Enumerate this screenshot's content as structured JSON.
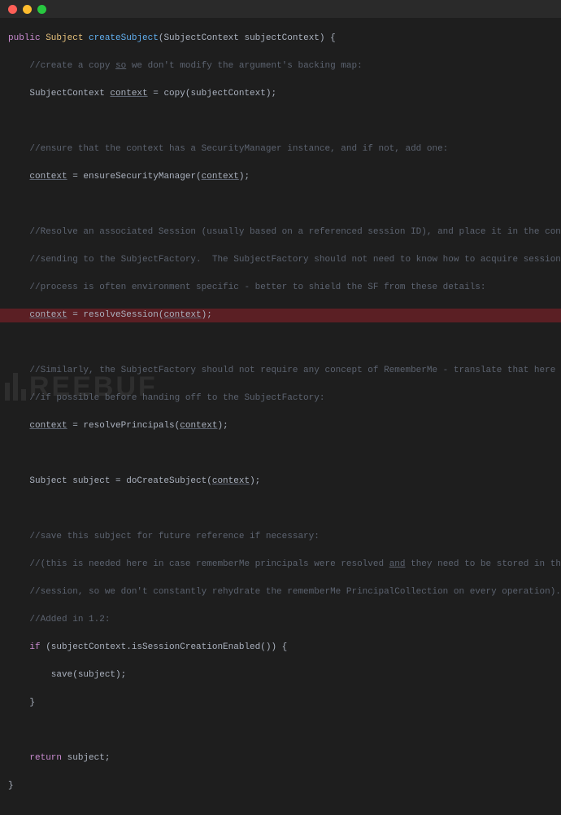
{
  "titlebar": {
    "dots": [
      "red",
      "yellow",
      "green"
    ]
  },
  "watermark": "REEBUF",
  "code": {
    "l01a": "public",
    "l01b": " Subject ",
    "l01c": "createSubject",
    "l01d": "(SubjectContext subjectContext) {",
    "l02a": "    //create a copy ",
    "l02b": "so",
    "l02c": " we don't modify the argument's backing map:",
    "l03a": "    SubjectContext ",
    "l03b": "context",
    "l03c": " = copy(subjectContext);",
    "l05": "    //ensure that the context has a SecurityManager instance, and if not, add one:",
    "l06a": "    ",
    "l06b": "context",
    "l06c": " = ensureSecurityManager(",
    "l06d": "context",
    "l06e": ");",
    "l08": "    //Resolve an associated Session (usually based on a referenced session ID), and place it in the context before",
    "l09": "    //sending to the SubjectFactory.  The SubjectFactory should not need to know how to acquire sessions as the",
    "l10": "    //process is often environment specific - better to shield the SF from these details:",
    "l11a": "    ",
    "l11b": "context",
    "l11c": " = resolveSession(",
    "l11d": "context",
    "l11e": ");",
    "l13": "    //Similarly, the SubjectFactory should not require any concept of RememberMe - translate that here first",
    "l14": "    //if possible before handing off to the SubjectFactory:",
    "l15a": "    ",
    "l15b": "context",
    "l15c": " = resolvePrincipals(",
    "l15d": "context",
    "l15e": ");",
    "l17a": "    Subject subject = doCreateSubject(",
    "l17b": "context",
    "l17c": ");",
    "l19": "    //save this subject for future reference if necessary:",
    "l20a": "    //(this is needed here in case rememberMe principals were resolved ",
    "l20b": "and",
    "l20c": " they need to be stored in the",
    "l21": "    //session, so we don't constantly rehydrate the rememberMe PrincipalCollection on every operation).",
    "l22": "    //Added in 1.2:",
    "l23a": "    ",
    "l23b": "if",
    "l23c": " (subjectContext.isSessionCreationEnabled()) {",
    "l24": "        save(subject);",
    "l25": "    }",
    "l27a": "    ",
    "l27b": "return",
    "l27c": " subject;",
    "l28": "}"
  }
}
